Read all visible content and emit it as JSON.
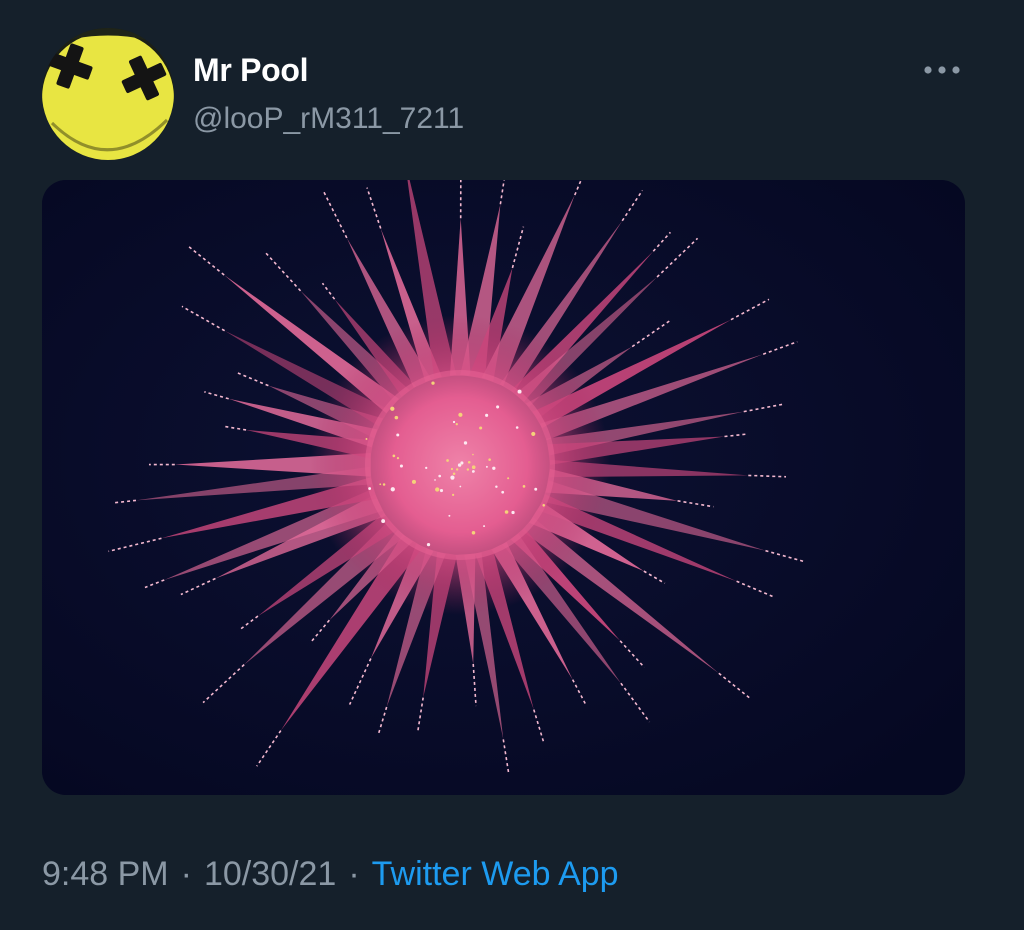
{
  "tweet": {
    "author": {
      "display_name": "Mr Pool",
      "handle": "@looP_rM311_7211",
      "avatar_icon": "deadpool-smiley-avatar"
    },
    "more_icon": "more-horizontal-icon",
    "media": {
      "subject": "pink-firework-photo"
    },
    "time": "9:48 PM",
    "separator": "·",
    "date": "10/30/21",
    "source": "Twitter Web App"
  },
  "colors": {
    "background": "#15202b",
    "primary_text": "#ffffff",
    "secondary_text": "#8b98a5",
    "link": "#1d9bf0",
    "avatar_yellow": "#e8e542",
    "firework_pink": "#e86d9c",
    "night_sky": "#070b26"
  }
}
